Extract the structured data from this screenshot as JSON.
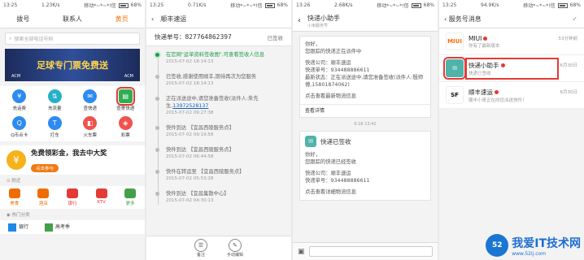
{
  "status": {
    "p1": {
      "time": "13:25",
      "speed": "1.23K/s",
      "carrier": "移动*~*~*!信",
      "battery": "68%"
    },
    "p2": {
      "time": "13:25",
      "speed": "0.71K/s",
      "carrier": "移动*~*~*!信",
      "battery": "68%"
    },
    "p3": {
      "time": "13:26",
      "speed": "2.68K/s",
      "carrier": "移动*~*~*!信",
      "battery": "68%"
    },
    "p4": {
      "time": "13:25",
      "speed": "94.9K/s",
      "carrier": "移动*~*~*!信",
      "battery": "68%"
    }
  },
  "phone1": {
    "tabs": [
      "拨号",
      "联系人",
      "黄页"
    ],
    "search_placeholder": "搜索全部电话号码",
    "banner": {
      "title": "足球专门票免费送",
      "team_left": "ACM",
      "team_right": "ACM"
    },
    "grid": [
      {
        "label": "充话费",
        "icon": "phone-charge-icon",
        "color": "#2d8bf0",
        "glyph": "¥"
      },
      {
        "label": "充流量",
        "icon": "data-icon",
        "color": "#29b0c9",
        "glyph": "⇅"
      },
      {
        "label": "查快递",
        "icon": "express-search-icon",
        "color": "#2d8bf0",
        "glyph": "✉"
      },
      {
        "label": "查寄快递",
        "icon": "courier-icon",
        "color": "#2fae53",
        "glyph": "▤"
      },
      {
        "label": "Q币点卡",
        "icon": "qcoin-icon",
        "color": "#2d8bf0",
        "glyph": "Q"
      },
      {
        "label": "打车",
        "icon": "taxi-icon",
        "color": "#2d8bf0",
        "glyph": "T"
      },
      {
        "label": "火车票",
        "icon": "train-icon",
        "color": "#ef5350",
        "glyph": "◧"
      },
      {
        "label": "彩票",
        "icon": "lottery-icon",
        "color": "#ef5350",
        "glyph": "◈"
      }
    ],
    "promo": {
      "title": "免费领彩金，我去中大奖",
      "button": "点击参与"
    },
    "nearby_label": "附近",
    "nearby": [
      {
        "label": "美食",
        "color": "#ef6c00"
      },
      {
        "label": "酒店",
        "color": "#ef6c00"
      },
      {
        "label": "银行",
        "color": "#e53935"
      },
      {
        "label": "KTV",
        "color": "#e53935"
      },
      {
        "label": "更多",
        "color": "#43a047"
      }
    ],
    "hot_label": "热门分类",
    "hot": [
      "银行",
      "高考季"
    ]
  },
  "phone2": {
    "title": "顺丰速运",
    "waybill": "快递单号：827764862397",
    "status": "已签收",
    "events": [
      {
        "text": "在官网\"运单资料签收图\",可查看签收人信息",
        "time": "2015-07-02 18:14:13"
      },
      {
        "text": "已签收,感谢使用顺丰,期待再次为您服务",
        "time": "2015-07-02 18:14:13"
      },
      {
        "text": "正在派送途中,请您准备签收(派件人:朱先生,",
        "phone": "13972528137",
        "time": "2015-07-02 09:27:38"
      },
      {
        "text": "快件到达 【宜昌西陵服务点】",
        "time": "2015-07-02 09:19:58"
      },
      {
        "text": "快件到达 【宜昌西陵服务点】",
        "time": "2015-07-02 06:44:58"
      },
      {
        "text": "快件在转运至 【宜昌西陵服务点】",
        "time": "2015-07-02 05:53:28"
      },
      {
        "text": "快件到达 【宜昌集散中心】",
        "time": "2015-07-02 04:30:13"
      }
    ],
    "bottom": [
      {
        "label": "备注",
        "glyph": "☰"
      },
      {
        "label": "手动编辑",
        "glyph": "✎"
      }
    ]
  },
  "phone3": {
    "title": "快递小助手",
    "subtitle": "小米服务号",
    "card1": {
      "lines": [
        "快递公司：顺丰速运",
        "快递单号：934488886611",
        "最新状态：正在派送途中,请您准备签收(派件人:殷师傅,15801874062)",
        "点击查看最新物流信息"
      ],
      "intro": "你好，",
      "sub": "您跟踪的快递正在派件中",
      "link": "查看详情"
    },
    "timestamp": "6:16 13:41",
    "card2": {
      "header": "快递已签收",
      "intro": "你好，",
      "sub": "您跟踪的快递已经签收",
      "lines": [
        "快递公司：顺丰速运",
        "快递单号：934488886611",
        "点击查看详细物流信息"
      ]
    }
  },
  "phone4": {
    "title": "服务号消息",
    "messages": [
      {
        "name": "MIUI",
        "sub": "你有了最新版本",
        "date": "53分钟前",
        "avatar": "MIUI",
        "avatar_bg": "#fff",
        "avatar_fg": "#ff6b00"
      },
      {
        "name": "快递小助手",
        "sub": "快递已签收",
        "date": "6月30日",
        "avatar": "✉",
        "avatar_bg": "#4fb3a9",
        "avatar_fg": "#fff"
      },
      {
        "name": "顺丰速运",
        "sub": "顺丰小哥正在向您派送快件！",
        "date": "6月30日",
        "avatar": "SF",
        "avatar_bg": "#fff",
        "avatar_fg": "#111"
      }
    ],
    "watermark": {
      "logo": "52",
      "text": "我爱IT技术网",
      "url": "www.52ij.com"
    }
  }
}
